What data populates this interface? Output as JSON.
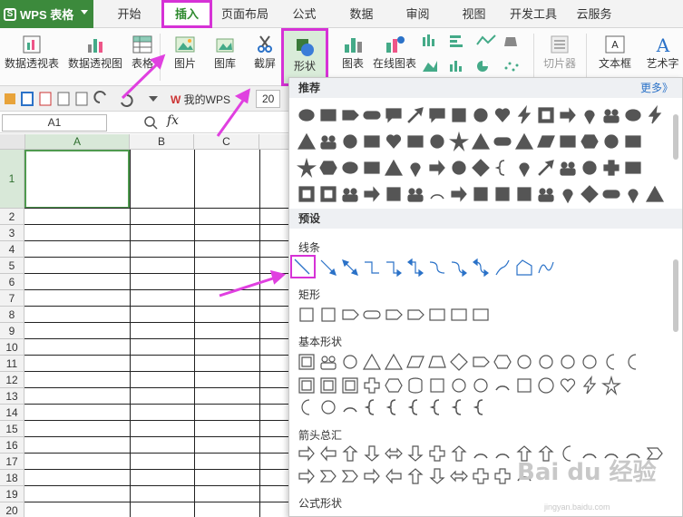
{
  "app": {
    "title": "WPS 表格"
  },
  "menu_tabs": [
    "开始",
    "插入",
    "页面布局",
    "公式",
    "数据",
    "审阅",
    "视图",
    "开发工具",
    "云服务"
  ],
  "ribbon": [
    {
      "label": "数据透视表",
      "icon": "pivot-table-icon"
    },
    {
      "label": "数据透视图",
      "icon": "pivot-chart-icon"
    },
    {
      "label": "表格",
      "icon": "table-icon"
    },
    {
      "label": "图片",
      "icon": "picture-icon"
    },
    {
      "label": "图库",
      "icon": "gallery-icon"
    },
    {
      "label": "截屏",
      "icon": "screenshot-icon"
    },
    {
      "label": "形状",
      "icon": "shape-icon"
    },
    {
      "label": "图表",
      "icon": "chart-icon"
    },
    {
      "label": "在线图表",
      "icon": "online-chart-icon"
    },
    {
      "label": "切片器",
      "icon": "slicer-icon"
    },
    {
      "label": "文本框",
      "icon": "textbox-icon"
    },
    {
      "label": "艺术字",
      "icon": "wordart-icon"
    }
  ],
  "quick_access": {
    "doc_tab": "我的WPS",
    "doc_tab2": "20"
  },
  "formula_bar": {
    "name_box": "A1",
    "fx": "fx"
  },
  "grid": {
    "columns": [
      "A",
      "B",
      "C"
    ],
    "rows": [
      "1",
      "2",
      "3",
      "4",
      "5",
      "6",
      "7",
      "8",
      "9",
      "10",
      "11",
      "12",
      "13",
      "14",
      "15",
      "16",
      "17",
      "18",
      "19",
      "20"
    ]
  },
  "panel": {
    "recommend": "推荐",
    "more": "更多》",
    "preset": "预设",
    "lines": "线条",
    "rectangles": "矩形",
    "basic": "基本形状",
    "arrows": "箭头总汇",
    "formula": "公式形状"
  },
  "watermark": {
    "text": "Bai du 经验",
    "url": "jingyan.baidu.com"
  },
  "colors": {
    "accent": "#2f8a2f",
    "highlight": "#d632d6"
  }
}
